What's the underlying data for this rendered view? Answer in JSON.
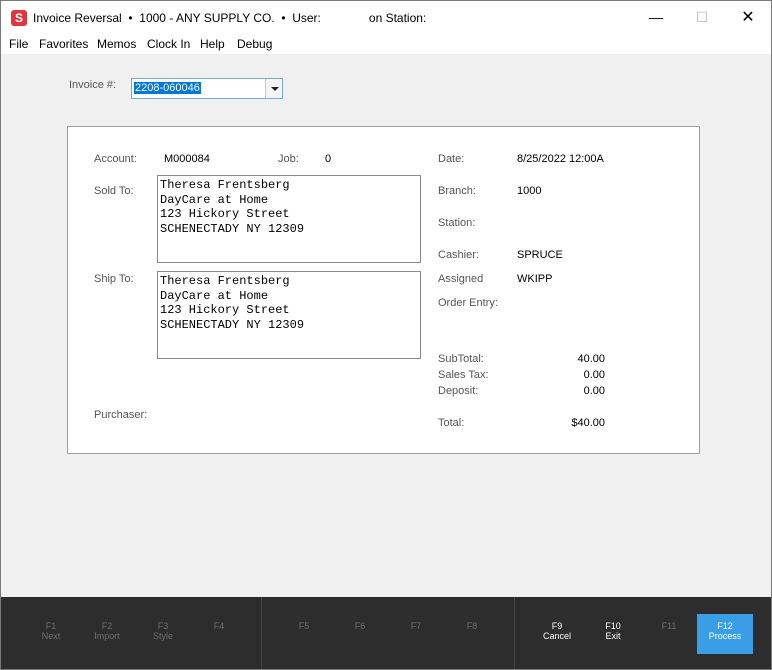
{
  "titlebar": {
    "app": "Invoice Reversal",
    "company": "1000 - ANY SUPPLY CO.",
    "user_label": "User:",
    "station_label": "on Station:"
  },
  "menu": [
    "File",
    "Favorites",
    "Memos",
    "Clock In",
    "Help",
    "Debug"
  ],
  "invoice": {
    "label": "Invoice #:",
    "value": "2208-060046"
  },
  "details": {
    "account_label": "Account:",
    "account": "M000084",
    "job_label": "Job:",
    "job": "0",
    "sold_to_label": "Sold To:",
    "sold_to": [
      "Theresa Frentsberg",
      "DayCare at Home",
      "123 Hickory Street",
      "SCHENECTADY NY 12309"
    ],
    "ship_to_label": "Ship To:",
    "ship_to": [
      "Theresa Frentsberg",
      "DayCare at Home",
      "123 Hickory Street",
      "SCHENECTADY NY 12309"
    ],
    "purchaser_label": "Purchaser:",
    "date_label": "Date:",
    "date": "8/25/2022 12:00A",
    "branch_label": "Branch:",
    "branch": "1000",
    "station_label": "Station:",
    "cashier_label": "Cashier:",
    "cashier": "SPRUCE",
    "assigned_label": "Assigned",
    "assigned": "WKIPP",
    "order_entry_label": "Order Entry:",
    "subtotal_label": "SubTotal:",
    "subtotal": "40.00",
    "sales_tax_label": "Sales Tax:",
    "sales_tax": "0.00",
    "deposit_label": "Deposit:",
    "deposit": "0.00",
    "total_label": "Total:",
    "total": "$40.00"
  },
  "fkeys": [
    {
      "key": "F1",
      "label": "Next"
    },
    {
      "key": "F2",
      "label": "Import"
    },
    {
      "key": "F3",
      "label": "Style"
    },
    {
      "key": "F4",
      "label": ""
    },
    {
      "key": "F5",
      "label": ""
    },
    {
      "key": "F6",
      "label": ""
    },
    {
      "key": "F7",
      "label": ""
    },
    {
      "key": "F8",
      "label": ""
    },
    {
      "key": "F9",
      "label": "Cancel"
    },
    {
      "key": "F10",
      "label": "Exit"
    },
    {
      "key": "F11",
      "label": ""
    },
    {
      "key": "F12",
      "label": "Process"
    }
  ],
  "colors": {
    "accent": "#3a9ee6",
    "fbar": "#2d2d2d",
    "app_icon": "#e0363d"
  }
}
